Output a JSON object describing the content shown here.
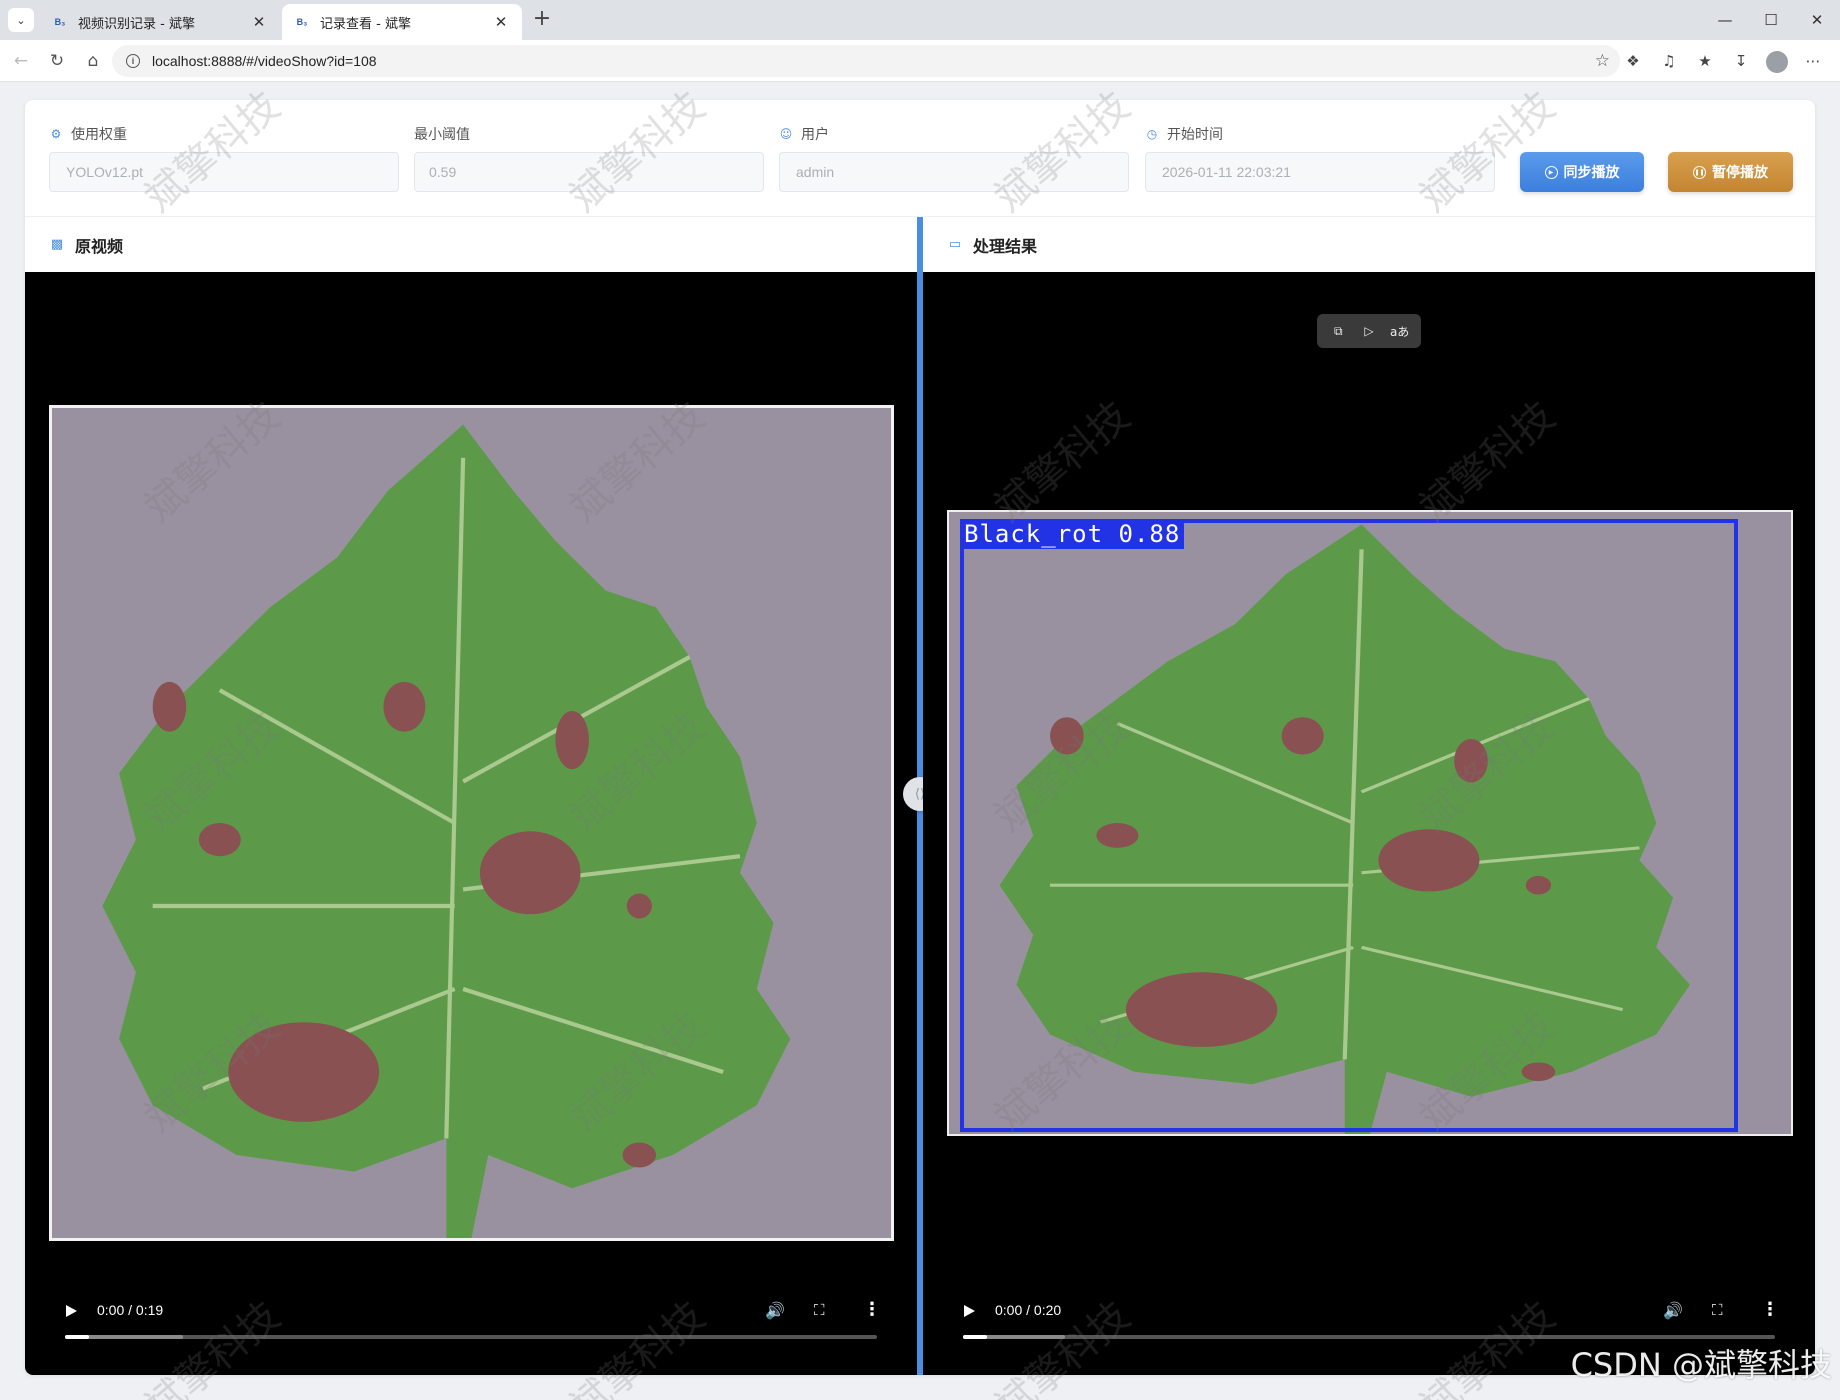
{
  "browser": {
    "tabs": [
      {
        "title": "视频识别记录 - 斌擎",
        "favicon": "B₃"
      },
      {
        "title": "记录查看 - 斌擎",
        "favicon": "B₃"
      }
    ],
    "url": "localhost:8888/#/videoShow?id=108"
  },
  "filters": {
    "weight": {
      "label": "使用权重",
      "value": "YOLOv12.pt",
      "icon": "gear-icon"
    },
    "threshold": {
      "label": "最小阈值",
      "value": "0.59"
    },
    "user": {
      "label": "用户",
      "value": "admin",
      "icon": "user-icon"
    },
    "start_time": {
      "label": "开始时间",
      "value": "2026-01-11 22:03:21",
      "icon": "clock-icon"
    }
  },
  "buttons": {
    "sync_play": "同步播放",
    "pause_play": "暂停播放"
  },
  "panels": {
    "original": {
      "title": "原视频",
      "time": "0:00 / 0:19",
      "played_fraction": 0.03,
      "buffered_fraction": 0.145
    },
    "result": {
      "title": "处理结果",
      "time": "0:00 / 0:20",
      "played_fraction": 0.03,
      "buffered_fraction": 0.125,
      "detection_label": "Black_rot 0.88"
    }
  },
  "watermark": "斌擎科技",
  "footer_watermark": "CSDN @斌擎科技",
  "colors": {
    "accent": "#4a8ee0",
    "sync_button": "#3b7fdd",
    "pause_button": "#c48530",
    "detection_box": "#2233e6"
  }
}
